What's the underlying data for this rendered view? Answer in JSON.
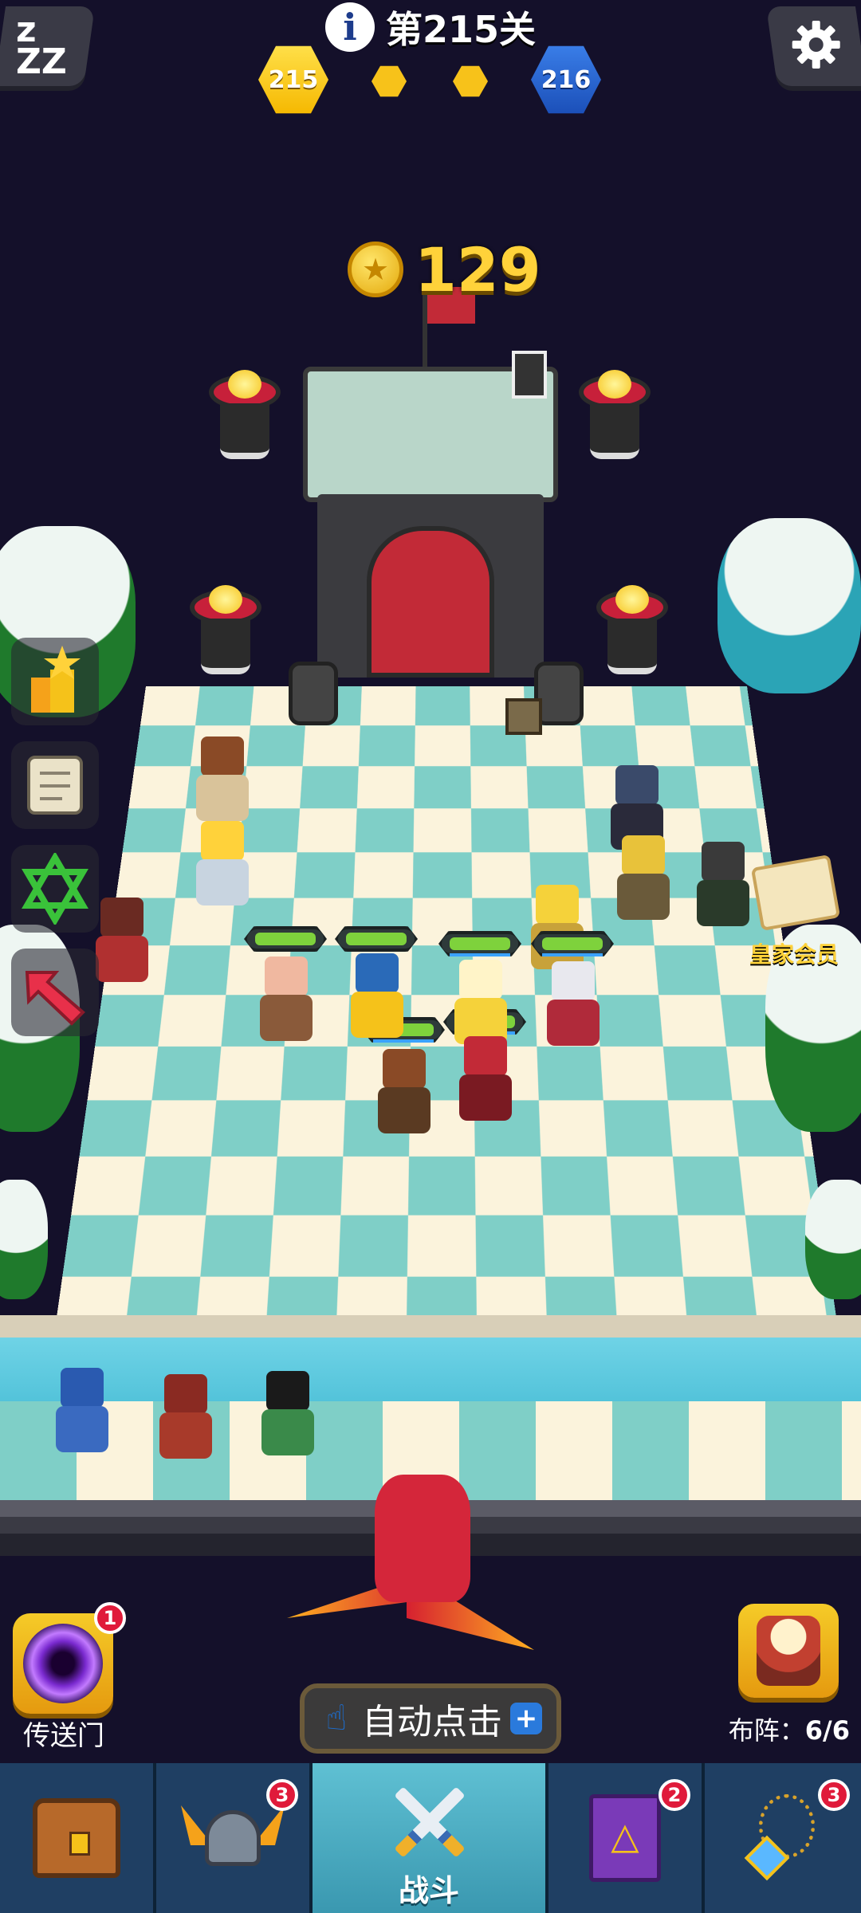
{
  "hud": {
    "level_label": "第215关",
    "current_level": "215",
    "next_level": "216"
  },
  "coins": {
    "value": "129"
  },
  "royal_member": {
    "label": "皇家会员"
  },
  "portal": {
    "label": "传送门",
    "badge": "1"
  },
  "formation": {
    "label": "布阵：",
    "count": "6/6"
  },
  "auto_click": {
    "label": "自动点击",
    "plus": "+"
  },
  "nav": {
    "items": [
      {
        "id": "chest",
        "label": "",
        "badge": ""
      },
      {
        "id": "heroes",
        "label": "",
        "badge": "3"
      },
      {
        "id": "battle",
        "label": "战斗",
        "badge": ""
      },
      {
        "id": "spellbook",
        "label": "",
        "badge": "2"
      },
      {
        "id": "artifacts",
        "label": "",
        "badge": "3"
      }
    ]
  },
  "colors": {
    "background": "#14102a",
    "accent_gold": "#ffd23a",
    "nav_active": "#4fb0c6",
    "badge_red": "#e01a3a",
    "hp_green": "#7ed23c"
  },
  "icons": [
    "sleep-icon",
    "info-icon",
    "settings-icon",
    "coin-icon",
    "trophy-icon",
    "scroll-icon",
    "star-icon",
    "arrow-icon",
    "portal-icon",
    "hero-icon",
    "hand-icon",
    "plus-icon",
    "chest-icon",
    "helmet-icon",
    "swords-icon",
    "book-icon",
    "amulet-icon"
  ]
}
